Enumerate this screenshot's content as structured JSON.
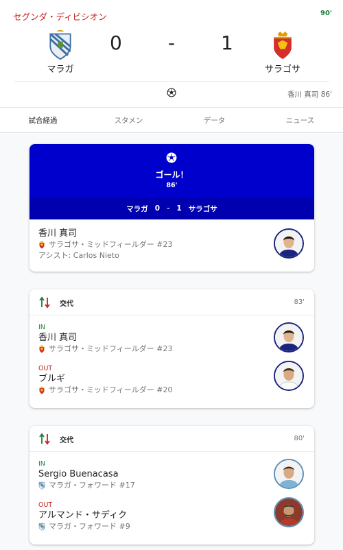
{
  "header": {
    "league": "セグンダ・ディビシオン",
    "minute": "90'",
    "home": {
      "name": "マラガ",
      "score": "0",
      "crest": "malaga-crest"
    },
    "away": {
      "name": "サラゴサ",
      "score": "1",
      "crest": "zaragoza-crest"
    },
    "dash": "-",
    "scorer_line": "香川 真司 86'"
  },
  "tabs": [
    {
      "label": "試合経過",
      "active": true
    },
    {
      "label": "スタメン"
    },
    {
      "label": "データ"
    },
    {
      "label": "ニュース"
    }
  ],
  "goal": {
    "title": "ゴール！",
    "minute": "86'",
    "bar": {
      "home": "マラガ",
      "home_score": "0",
      "sep": "-",
      "away_score": "1",
      "away": "サラゴサ"
    },
    "player": "香川 真司",
    "meta": "サラゴサ・ミッドフィールダー #23",
    "assist": "アシスト: Carlos Nieto"
  },
  "subs": [
    {
      "title": "交代",
      "minute": "83'",
      "in_label": "IN",
      "in_player": "香川 真司",
      "in_meta": "サラゴサ・ミッドフィールダー #23",
      "out_label": "OUT",
      "out_player": "ブルギ",
      "out_meta": "サラゴサ・ミッドフィールダー #20"
    },
    {
      "title": "交代",
      "minute": "80'",
      "in_label": "IN",
      "in_player": "Sergio Buenacasa",
      "in_meta": "マラガ・フォワード #17",
      "out_label": "OUT",
      "out_player": "アルマンド・サディク",
      "out_meta": "マラガ・フォワード #9"
    }
  ],
  "colors": {
    "accent_red": "#c5221f",
    "goal_blue": "#0000cc",
    "in_green": "#188038"
  }
}
